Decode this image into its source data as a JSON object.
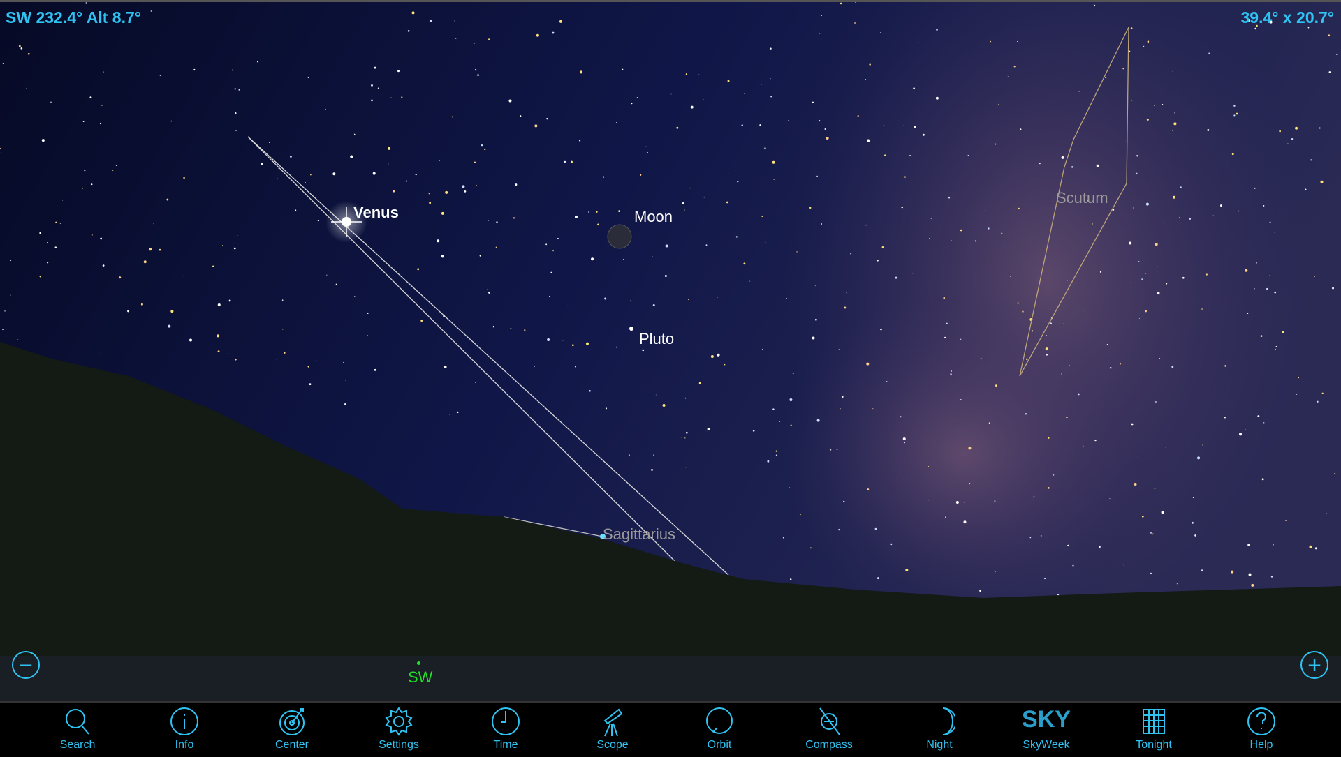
{
  "header": {
    "direction_readout": "SW 232.4° Alt 8.7°",
    "fov_readout": "39.4° x 20.7°"
  },
  "sky_labels": {
    "venus": "Venus",
    "moon": "Moon",
    "pluto": "Pluto"
  },
  "constellations": {
    "sagittarius": "Sagittarius",
    "scutum": "Scutum"
  },
  "cardinal": "SW",
  "zoom": {
    "out_icon": "minus-circle-icon",
    "in_icon": "plus-circle-icon"
  },
  "toolbar": [
    {
      "label": "Search",
      "icon": "search-icon"
    },
    {
      "label": "Info",
      "icon": "info-icon"
    },
    {
      "label": "Center",
      "icon": "target-icon"
    },
    {
      "label": "Settings",
      "icon": "gear-icon"
    },
    {
      "label": "Time",
      "icon": "clock-icon"
    },
    {
      "label": "Scope",
      "icon": "telescope-icon"
    },
    {
      "label": "Orbit",
      "icon": "orbit-icon"
    },
    {
      "label": "Compass",
      "icon": "compass-icon"
    },
    {
      "label": "Night",
      "icon": "moon-icon"
    },
    {
      "label": "SkyWeek",
      "icon": "sky-telescope-logo",
      "logo_text": "SKY"
    },
    {
      "label": "Tonight",
      "icon": "calendar-icon"
    },
    {
      "label": "Help",
      "icon": "help-icon"
    }
  ],
  "colors": {
    "accent": "#2fc3f2",
    "cardinal": "#22e02a",
    "sky": "#0a0f35"
  }
}
